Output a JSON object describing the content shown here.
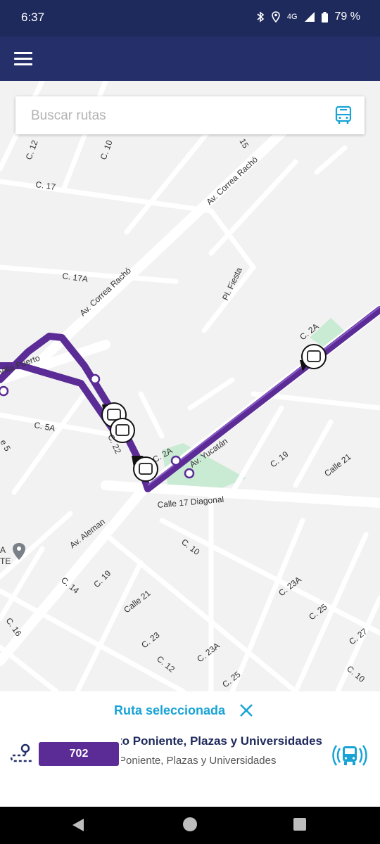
{
  "status_bar": {
    "time": "6:37",
    "network": "4G",
    "battery": "79 %"
  },
  "search": {
    "placeholder": "Buscar rutas"
  },
  "map": {
    "streets": {
      "c12_top": "C. 12",
      "c10_top": "C. 10",
      "c15_top": "15",
      "c17": "C. 17",
      "correa_racho_1": "Av. Correa Rachó",
      "correa_racho_2": "Av. Correa Rachó",
      "c17a": "C. 17A",
      "pi_fiesta": "Pl. Fiesta",
      "c2a_upper": "C. 2A",
      "puerto": "Villa Puerto",
      "c5a": "C. 5A",
      "c5": "e 5",
      "c22": "C. 22",
      "c2a_lower": "C. 2A",
      "av_yucatan": "Av. Yucatán",
      "c19_right": "C. 19",
      "calle21_right": "Calle 21",
      "calle17_diagonal": "Calle 17 Diagonal",
      "av_aleman": "Av. Aleman",
      "c10_mid": "C. 10",
      "c19_mid": "C. 19",
      "c14": "C. 14",
      "calle21_mid": "Calle 21",
      "c23a_right": "C. 23A",
      "c16": "C. 16",
      "c23": "C. 23",
      "c25_right": "C. 25",
      "c27": "C. 27",
      "c12_bottom": "C. 12",
      "c23a_bottom": "C. 23A",
      "c25_bottom": "C. 25",
      "c10_bottom": "C. 10",
      "poi_a": "A",
      "poi_te": "TE"
    },
    "colors": {
      "route": "#5b2c96",
      "park": "#c9ebd3",
      "road": "#ffffff"
    }
  },
  "panel": {
    "title": "Ruta seleccionada",
    "route_number": "702",
    "route_name": "Circuito Poniente, Plazas y Universidades",
    "route_subtitle": "Poniente, Plazas y Universidades"
  },
  "icons": {
    "menu": "menu-icon",
    "search_bus": "bus-icon",
    "close": "close-icon",
    "route_pin": "route-pin-icon",
    "live_bus": "live-bus-icon"
  }
}
